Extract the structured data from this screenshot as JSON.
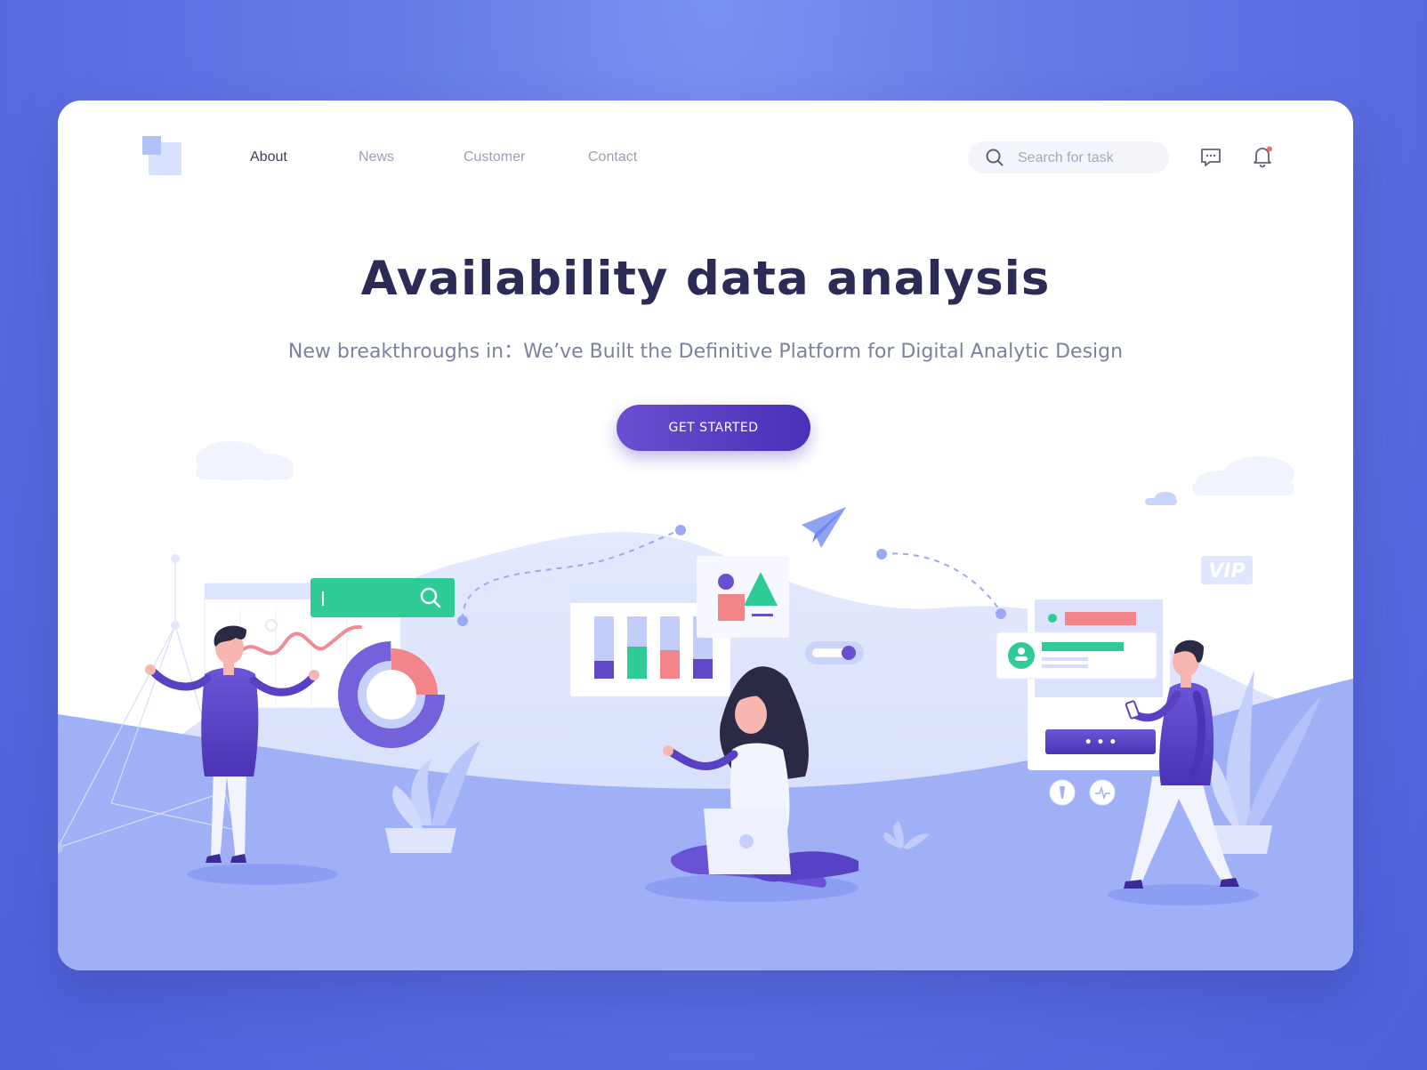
{
  "nav": {
    "items": [
      {
        "label": "About",
        "active": true
      },
      {
        "label": "News",
        "active": false
      },
      {
        "label": "Customer",
        "active": false
      },
      {
        "label": "Contact",
        "active": false
      }
    ]
  },
  "search": {
    "placeholder": "Search for task",
    "value": ""
  },
  "header_icons": {
    "chat": "chat-icon",
    "bell": "bell-icon"
  },
  "hero": {
    "title": "Availability data analysis",
    "subtitle": "New breakthroughs in：We’ve Built the Definitive Platform for Digital Analytic Design",
    "cta_label": "GET STARTED"
  },
  "illustration": {
    "vip_label": "VIP",
    "dots": "• • •"
  },
  "colors": {
    "background": "#5f71e3",
    "primary": "#5b3fc6",
    "title": "#2c2b55",
    "accent_green": "#2ec996",
    "accent_red": "#f3848a",
    "ground": "#9fb0f7"
  }
}
